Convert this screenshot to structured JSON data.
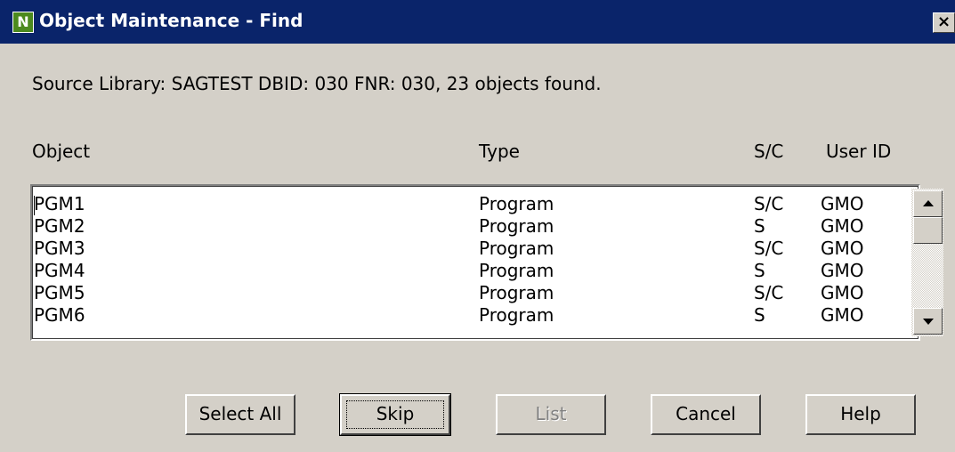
{
  "window": {
    "title": "Object Maintenance - Find",
    "icon_letter": "N",
    "close_glyph": "×"
  },
  "info": {
    "text": "Source Library: SAGTEST  DBID: 030  FNR: 030, 23 objects found."
  },
  "columns": {
    "object": "Object",
    "type": "Type",
    "sc": "S/C",
    "user": "User ID"
  },
  "rows": [
    {
      "object": "PGM1",
      "type": "Program",
      "sc": "S/C",
      "user": "GMO"
    },
    {
      "object": "PGM2",
      "type": "Program",
      "sc": "S",
      "user": "GMO"
    },
    {
      "object": "PGM3",
      "type": "Program",
      "sc": "S/C",
      "user": "GMO"
    },
    {
      "object": "PGM4",
      "type": "Program",
      "sc": "S",
      "user": "GMO"
    },
    {
      "object": "PGM5",
      "type": "Program",
      "sc": "S/C",
      "user": "GMO"
    },
    {
      "object": "PGM6",
      "type": "Program",
      "sc": "S",
      "user": "GMO"
    }
  ],
  "scrollbar": {
    "up_icon": "scroll-up-arrow",
    "down_icon": "scroll-down-arrow"
  },
  "buttons": {
    "select_all": "Select All",
    "skip": "Skip",
    "list": "List",
    "cancel": "Cancel",
    "help": "Help",
    "list_enabled": false
  },
  "colors": {
    "titlebar": "#0a246a",
    "face": "#d4d0c8",
    "disabled_text": "#808080"
  }
}
